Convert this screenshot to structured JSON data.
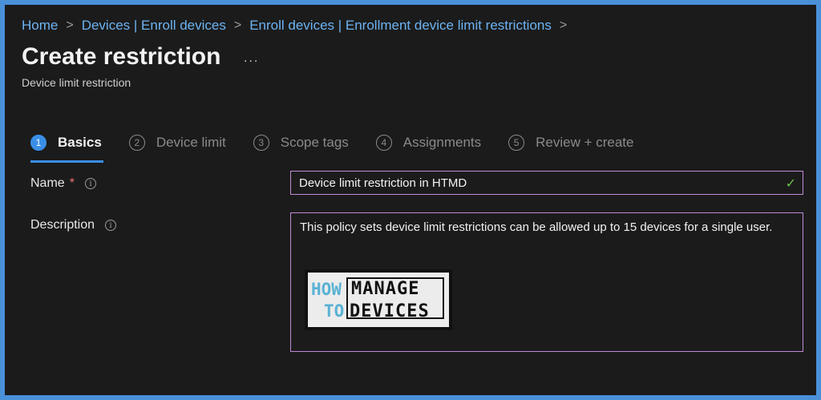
{
  "breadcrumb": {
    "items": [
      "Home",
      "Devices | Enroll devices",
      "Enroll devices | Enrollment device limit restrictions"
    ],
    "separator": ">"
  },
  "header": {
    "title": "Create restriction",
    "more": "...",
    "subtitle": "Device limit restriction"
  },
  "steps": [
    {
      "num": "1",
      "label": "Basics"
    },
    {
      "num": "2",
      "label": "Device limit"
    },
    {
      "num": "3",
      "label": "Scope tags"
    },
    {
      "num": "4",
      "label": "Assignments"
    },
    {
      "num": "5",
      "label": "Review + create"
    }
  ],
  "form": {
    "name_label": "Name",
    "name_required": "*",
    "name_value": "Device limit restriction in HTMD",
    "description_label": "Description",
    "description_value": "This policy sets device limit restrictions can be allowed up to 15 devices for a single user.",
    "info_glyph": "i",
    "check_glyph": "✓"
  },
  "logo": {
    "how": "HOW",
    "to": "TO",
    "manage": "MANAGE",
    "devices": "DEVICES"
  },
  "colors": {
    "accent": "#3a8ee6",
    "link": "#6db3f2",
    "field_border": "#c08bd6",
    "valid": "#6cc04a",
    "required": "#f17272",
    "frame": "#4a90d9"
  }
}
